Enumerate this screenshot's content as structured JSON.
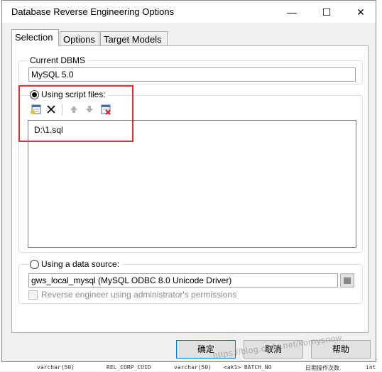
{
  "dialog": {
    "title": "Database Reverse Engineering Options",
    "controls": {
      "minimize": "—",
      "maximize": "☐",
      "close": "✕"
    }
  },
  "tabs": [
    {
      "label": "Selection",
      "active": true
    },
    {
      "label": "Options",
      "active": false
    },
    {
      "label": "Target Models",
      "active": false
    }
  ],
  "current_dbms": {
    "label": "Current DBMS",
    "value": "MySQL 5.0"
  },
  "script_files": {
    "label": "Using script files:",
    "selected": true,
    "toolbar": [
      "add-file-icon",
      "delete-icon",
      "move-up-icon",
      "move-down-icon",
      "clear-icon"
    ],
    "files": [
      "D:\\1.sql"
    ]
  },
  "data_source": {
    "label": "Using a data source:",
    "selected": false,
    "value": "gws_local_mysql (MySQL ODBC 8.0 Unicode Driver)"
  },
  "admin_permissions": {
    "label": "Reverse engineer using administrator's permissions",
    "checked": false
  },
  "buttons": {
    "ok": "确定",
    "cancel": "取消",
    "help": "帮助"
  },
  "background_text": {
    "bottom": [
      "varchar(50)",
      "REL_CORP_CUID",
      "varchar(50)",
      "<ak1> BATCH_NO",
      "日期操作次数",
      "int"
    ],
    "watermark": "https://blog.csdn.net/kornysnow"
  },
  "colors": {
    "highlight": "#e03030",
    "dialog_bg": "#f0f0f0",
    "default_button_border": "#0078d7"
  }
}
